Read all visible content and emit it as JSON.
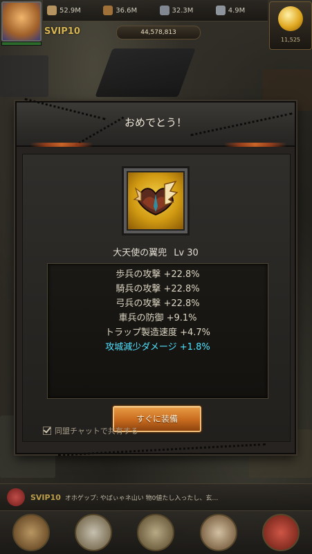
{
  "hud": {
    "resources": [
      {
        "icon": "food-icon",
        "value": "52.9M",
        "color": "#c9a36a"
      },
      {
        "icon": "wood-icon",
        "value": "36.6M",
        "color": "#b07a3a"
      },
      {
        "icon": "stone-icon",
        "value": "32.3M",
        "color": "#8f97a4"
      },
      {
        "icon": "iron-icon",
        "value": "4.9M",
        "color": "#9fa6b0"
      }
    ],
    "vip_label": "SVIP10",
    "power": "44,578,813",
    "gold": "11,525"
  },
  "dialog": {
    "title": "おめでとう！",
    "item_name": "大天使の翼兜",
    "item_level": "Lv 30",
    "stats": [
      {
        "text": "歩兵の攻撃 +22.8%",
        "highlight": false
      },
      {
        "text": "騎兵の攻撃 +22.8%",
        "highlight": false
      },
      {
        "text": "弓兵の攻撃 +22.8%",
        "highlight": false
      },
      {
        "text": "車兵の防御 +9.1%",
        "highlight": false
      },
      {
        "text": "トラップ製造速度 +4.7%",
        "highlight": false
      },
      {
        "text": "攻城減少ダメージ +1.8%",
        "highlight": true
      }
    ],
    "equip_button": "すぐに装備",
    "share_label": "同盟チャットで共有する",
    "share_checked": true
  },
  "chat": {
    "vip": "SVIP10",
    "message": "オホゲップ: やばぃゃネ山い 物0値たし入ったし、玄…"
  }
}
